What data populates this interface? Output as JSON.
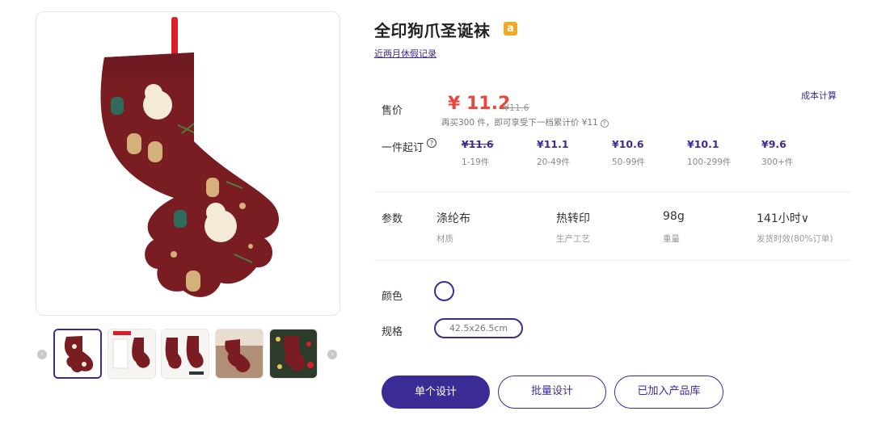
{
  "product": {
    "title": "全印狗爪圣诞袜",
    "brand_badge": "a",
    "history_link": "近两月休假记录"
  },
  "pricing": {
    "label": "售价",
    "price": "¥ 11.2",
    "original_price": "¥11.6",
    "cost_calc_link": "成本计算",
    "hint": "再买300 件，即可享受下一档累计价 ¥11",
    "hint_icon": "?"
  },
  "moq": {
    "label": "一件起订",
    "help_icon": "?",
    "tiers": [
      {
        "price": "¥11.6",
        "range": "1-19件",
        "struck": true
      },
      {
        "price": "¥11.1",
        "range": "20-49件",
        "struck": false
      },
      {
        "price": "¥10.6",
        "range": "50-99件",
        "struck": false
      },
      {
        "price": "¥10.1",
        "range": "100-299件",
        "struck": false
      },
      {
        "price": "¥9.6",
        "range": "300+件",
        "struck": false
      }
    ]
  },
  "params": {
    "label": "参数",
    "items": [
      {
        "value": "涤纶布",
        "key": "材质"
      },
      {
        "value": "热转印",
        "key": "生产工艺"
      },
      {
        "value": "98g",
        "key": "重量"
      },
      {
        "value": "141小时∨",
        "key": "发货时效(80%订单)"
      }
    ]
  },
  "options": {
    "color_label": "颜色",
    "size_label": "规格",
    "size_value": "42.5x26.5cm"
  },
  "actions": {
    "single_design": "单个设计",
    "batch_design": "批量设计",
    "added_to_library": "已加入产品库"
  },
  "thumbnails": {
    "left_arrow": "‹",
    "right_arrow": "›",
    "count": 5
  },
  "colors": {
    "accent": "#3b2c95",
    "price_red": "#e8473e",
    "stocking_red": "#7a1d22",
    "badge_orange": "#f5a623"
  }
}
